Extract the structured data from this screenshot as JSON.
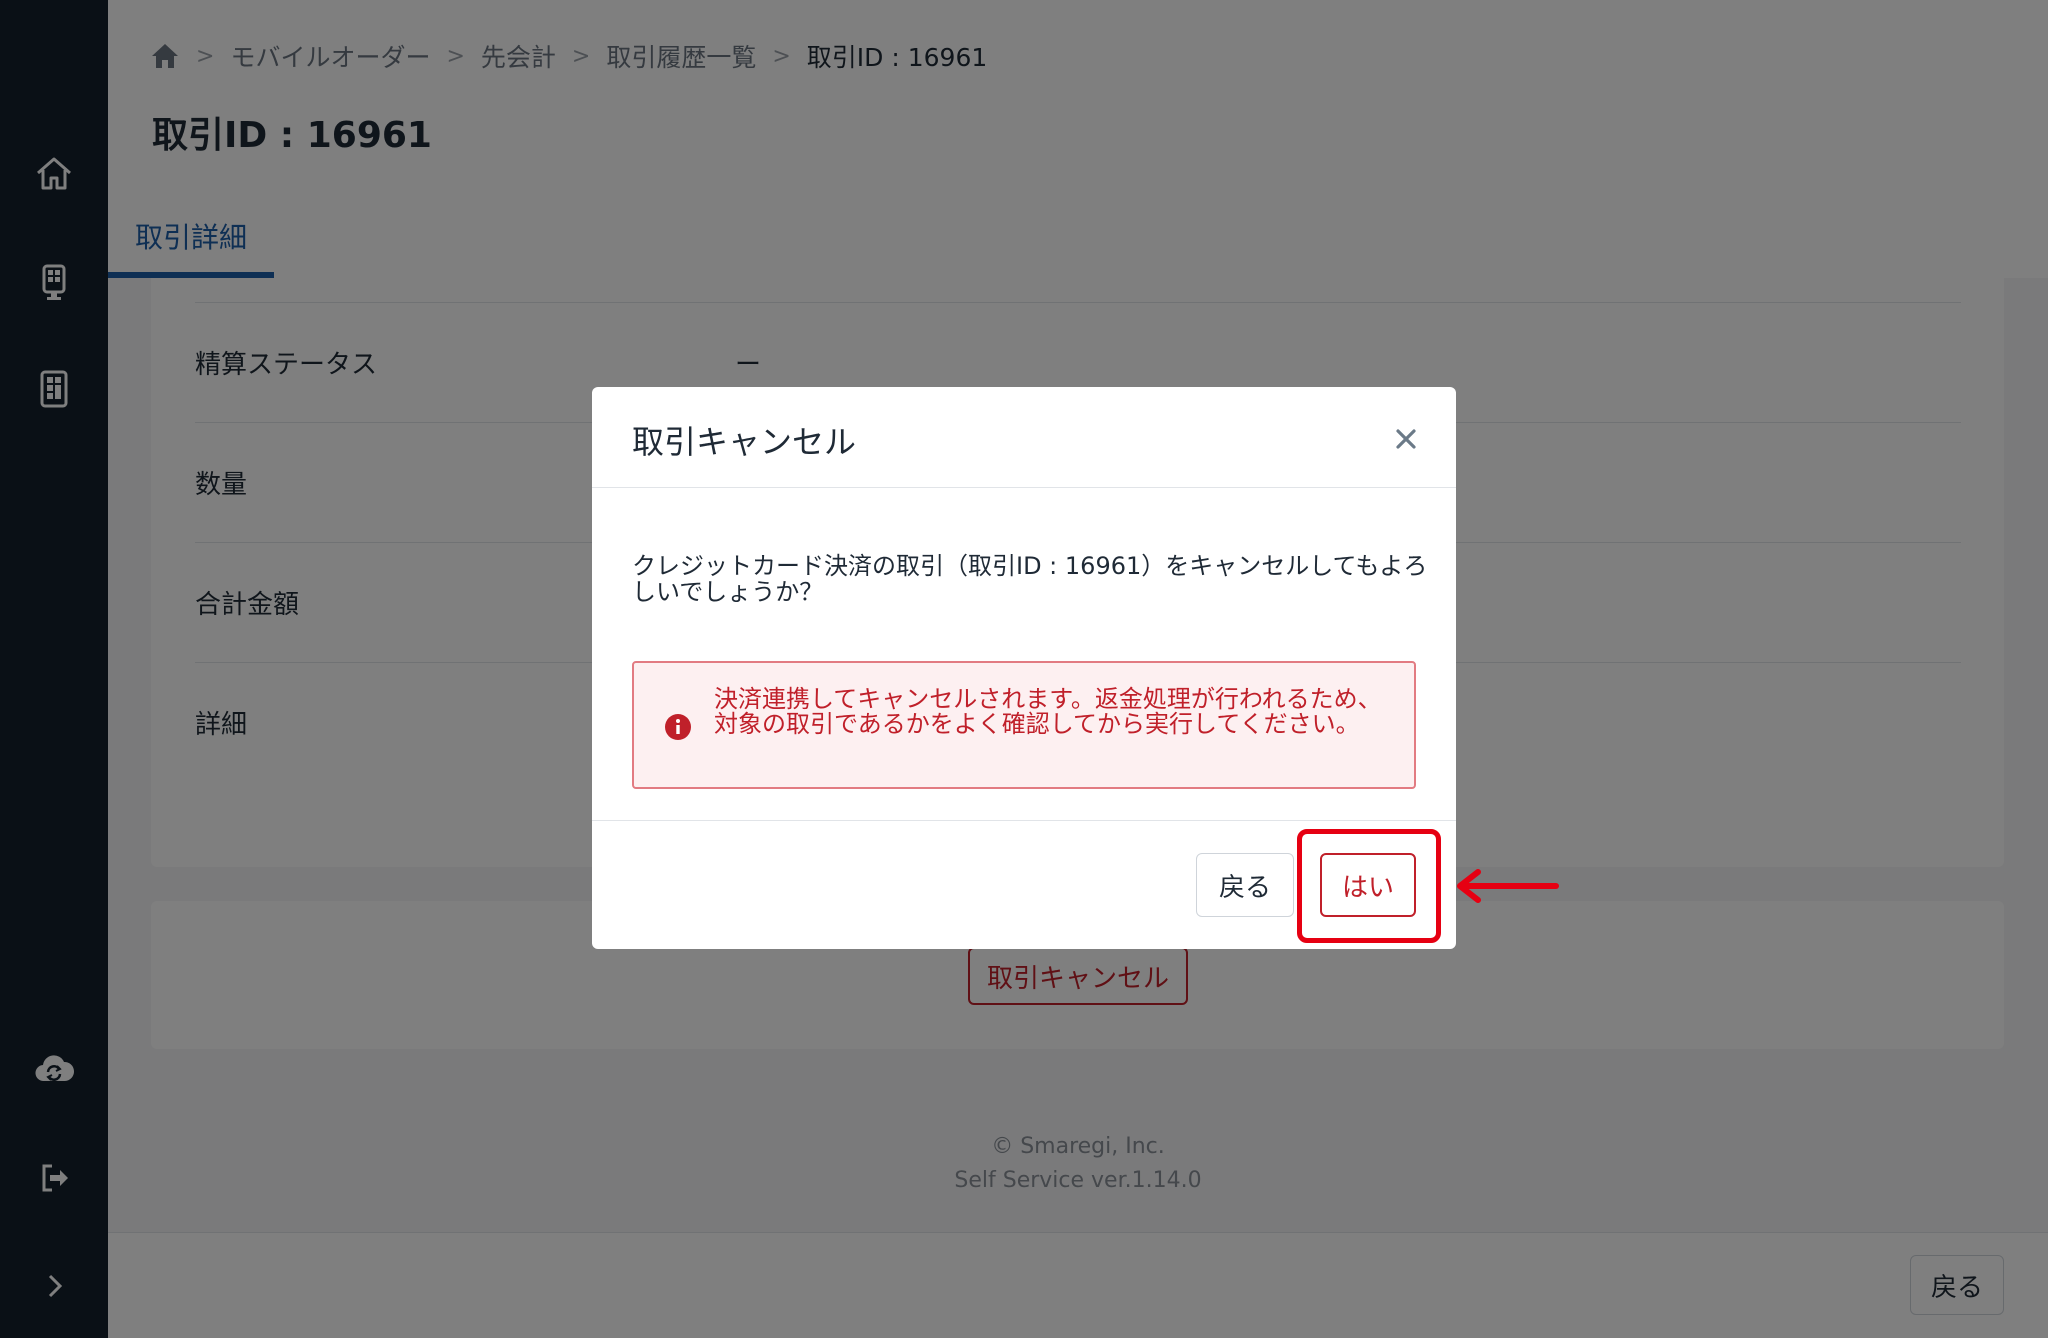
{
  "breadcrumb": {
    "home_icon": "home-icon",
    "items": [
      "モバイルオーダー",
      "先会計",
      "取引履歴一覧"
    ],
    "current": "取引ID : 16961"
  },
  "page": {
    "title": "取引ID : 16961",
    "tab": "取引詳細"
  },
  "details": [
    {
      "label": "精算ステータス",
      "value": "ー"
    },
    {
      "label": "数量",
      "value": ""
    },
    {
      "label": "合計金額",
      "value": ""
    },
    {
      "label": "詳細",
      "value": ""
    }
  ],
  "actions": {
    "cancel_label": "取引キャンセル"
  },
  "footer": {
    "copyright": "© Smaregi, Inc.",
    "version": "Self Service ver.1.14.0"
  },
  "bottom_bar": {
    "back_label": "戻る"
  },
  "sidebar": {
    "icons": [
      "home-icon",
      "kiosk-icon",
      "tablet-icon",
      "cloud-sync-icon",
      "logout-icon",
      "expand-icon"
    ]
  },
  "modal": {
    "title": "取引キャンセル",
    "message": "クレジットカード決済の取引（取引ID : 16961）をキャンセルしてもよろしいでしょうか？",
    "alert": "決済連携してキャンセルされます。返金処理が行われるため、対象の取引であるかをよく確認してから実行してください。",
    "back_label": "戻る",
    "confirm_label": "はい"
  },
  "colors": {
    "sidebar": "#15212d",
    "accent": "#1c5ea8",
    "danger": "#c0202a",
    "annotation": "#e60012"
  }
}
